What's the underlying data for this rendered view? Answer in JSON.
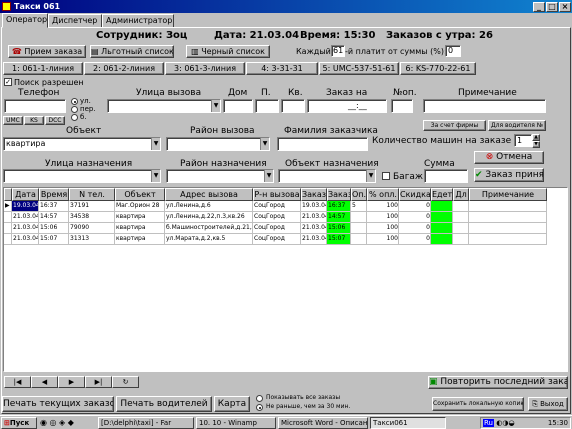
{
  "window": {
    "title": "Такси 061"
  },
  "tabs": [
    "Оператор",
    "Диспетчер",
    "Администратор"
  ],
  "header": {
    "employee": "Сотрудник: Зоц",
    "date": "Дата: 21.03.04",
    "time": "Время: 15:30",
    "orders": "Заказов с утра: 26"
  },
  "toolbar": {
    "receive_order": "Прием заказа",
    "discount_list": "Льготный список",
    "black_list": "Черный список",
    "every_prefix": "Каждый",
    "every_value": "61",
    "every_suffix": "-й платит от суммы (%):",
    "percent_value": "0"
  },
  "lines": [
    "1: 061-1-линия",
    "2: 061-2-линия",
    "3: 061-3-линия",
    "4: 3-31-31",
    "5: UMC-537-51-61",
    "6: KS-770-22-61"
  ],
  "search": {
    "label": "Поиск разрешен",
    "checked": true
  },
  "form": {
    "phone_label": "Телефон",
    "radio_labels": [
      "ул.",
      "пер.",
      "б."
    ],
    "op_buttons": [
      "UMC",
      "KS",
      "DCC"
    ],
    "street_call_label": "Улица вызова",
    "house_label": "Дом",
    "entrance_label": "П.",
    "apt_label": "Кв.",
    "order_at_label": "Заказ на",
    "order_at_value": "__:__",
    "op_no_label": "№оп.",
    "note_label": "Примечание",
    "firm_account": "За счет фирмы",
    "for_driver": "Для водителя №",
    "object_label": "Объект",
    "object_value": "квартира",
    "district_call_label": "Район вызова",
    "customer_label": "Фамилия заказчика",
    "car_count_label": "Количество машин на заказе",
    "car_count_value": "1",
    "cancel_label": "Отмена",
    "dest_street_label": "Улица назначения",
    "dest_district_label": "Район назначения",
    "dest_object_label": "Объект назначения",
    "sum_label": "Сумма",
    "baggage_label": "Багаж",
    "accept_label": "Заказ принят"
  },
  "grid": {
    "columns": [
      "Дата",
      "Время",
      "N тел.",
      "Объект",
      "Адрес вызова",
      "Р-н вызова",
      "Заказ",
      "Заказ",
      "Оп.",
      "% опл.",
      "Скидка",
      "Едет",
      "Дл",
      "Примечание"
    ],
    "rows": [
      [
        "19.03.04",
        "16:37",
        "37191",
        "Маг.Орион 28",
        "ул.Ленина,д.6",
        "СоцГород",
        "19.03.04",
        "16:37",
        "5",
        "100",
        "0",
        "",
        "",
        ""
      ],
      [
        "21.03.04",
        "14:57",
        "34538",
        "квартира",
        "ул.Ленина,д.22,п.3,кв.26",
        "СоцГород",
        "21.03.04",
        "14:57",
        "",
        "100",
        "0",
        "",
        "",
        ""
      ],
      [
        "21.03.04",
        "15:06",
        "79090",
        "квартира",
        "б.Машиностроителей,д.21,кв.1",
        "СоцГород",
        "21.03.04",
        "15:06",
        "",
        "100",
        "0",
        "",
        "",
        ""
      ],
      [
        "21.03.04",
        "15:07",
        "31313",
        "квартира",
        "ул.Марата,д.2,кв.5",
        "СоцГород",
        "21.03.04",
        "15:07",
        "",
        "100",
        "0",
        "",
        "",
        ""
      ]
    ]
  },
  "nav": [
    "|◀",
    "◀",
    "▶",
    "▶|",
    "↻"
  ],
  "repeat_last": "Повторить последний заказ",
  "bottom": {
    "print_orders": "Печать текущих заказов",
    "print_drivers": "Печать водителей",
    "map": "Карта",
    "show_all": "Показывать все заказы",
    "not_earlier": "Не раньше, чем за 30 мин.",
    "save_copy": "Сохранить локальную копию",
    "exit": "Выход"
  },
  "taskbar": {
    "start": "Пуск",
    "items": [
      "[D:\\delphi\\taxi] - Far",
      "10. 10 - Winamp",
      "Microsoft Word - Описани...",
      "Такси061"
    ],
    "lang": "Ru",
    "clock": "15:30"
  }
}
